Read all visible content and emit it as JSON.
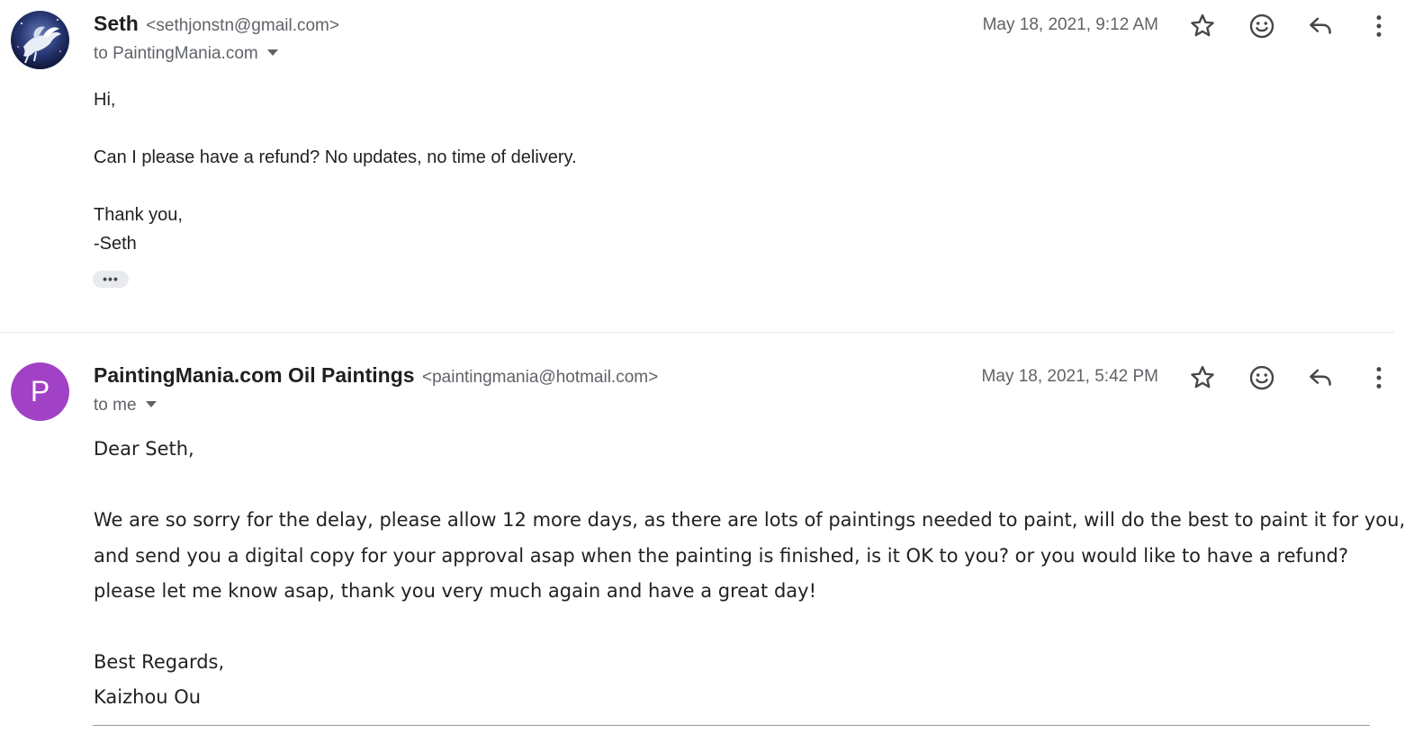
{
  "messages": [
    {
      "sender_name": "Seth",
      "sender_email": "<sethjonstn@gmail.com>",
      "recipient": "to PaintingMania.com",
      "timestamp": "May 18, 2021, 9:12 AM",
      "avatar": "photo-avatar",
      "body": {
        "greeting": "Hi,",
        "line1": "Can I please have a refund? No updates, no time of delivery.",
        "closing": "Thank you,",
        "signature": "-Seth"
      },
      "trimmed_content_label": "•••"
    },
    {
      "sender_name": "PaintingMania.com Oil Paintings",
      "sender_email": "<paintingmania@hotmail.com>",
      "recipient": "to me",
      "timestamp": "May 18, 2021, 5:42 PM",
      "avatar_letter": "P",
      "avatar_color": "#a142c6",
      "body": {
        "greeting": "Dear Seth,",
        "paragraph": "We are so sorry for the delay, please allow 12 more days, as there are lots of paintings needed to paint, will do the best to paint it for you, and send you a digital copy for your approval asap when the painting is finished, is it OK to you? or you would like to have a refund? please let me know asap, thank you very much again and have a great day!",
        "closing": "Best Regards,",
        "signature": "Kaizhou Ou"
      }
    }
  ],
  "icons": {
    "star": "star-icon",
    "emoji": "emoji-icon",
    "reply": "reply-icon",
    "more": "more-vert-icon"
  }
}
